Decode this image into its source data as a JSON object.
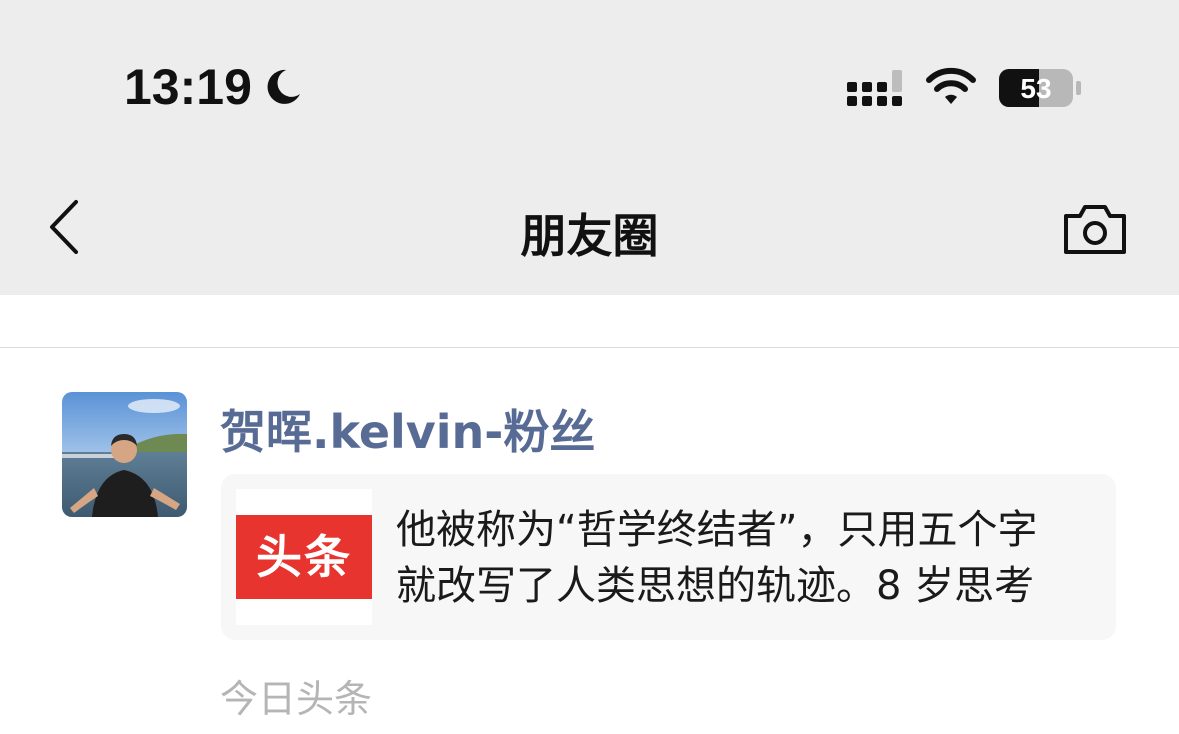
{
  "status_bar": {
    "time": "13:19",
    "battery_level": "53",
    "icons": [
      "moon-icon",
      "cellular-signal-icon",
      "wifi-icon",
      "battery-icon"
    ]
  },
  "nav": {
    "title": "朋友圈",
    "back_icon": "chevron-left-icon",
    "camera_icon": "camera-icon"
  },
  "post": {
    "author": "贺晖.kelvin-粉丝",
    "link": {
      "thumbnail_text": "头条",
      "title_line1": "他被称为“哲学终结者”，只用五个字",
      "title_line2": "就改写了人类思想的轨迹。8 岁思考"
    },
    "source": "今日头条"
  },
  "colors": {
    "header_bg": "#ededed",
    "username": "#576b95",
    "toutiao_red": "#e8342f",
    "card_bg": "#f7f7f7",
    "source_text": "#b5b5b5"
  }
}
